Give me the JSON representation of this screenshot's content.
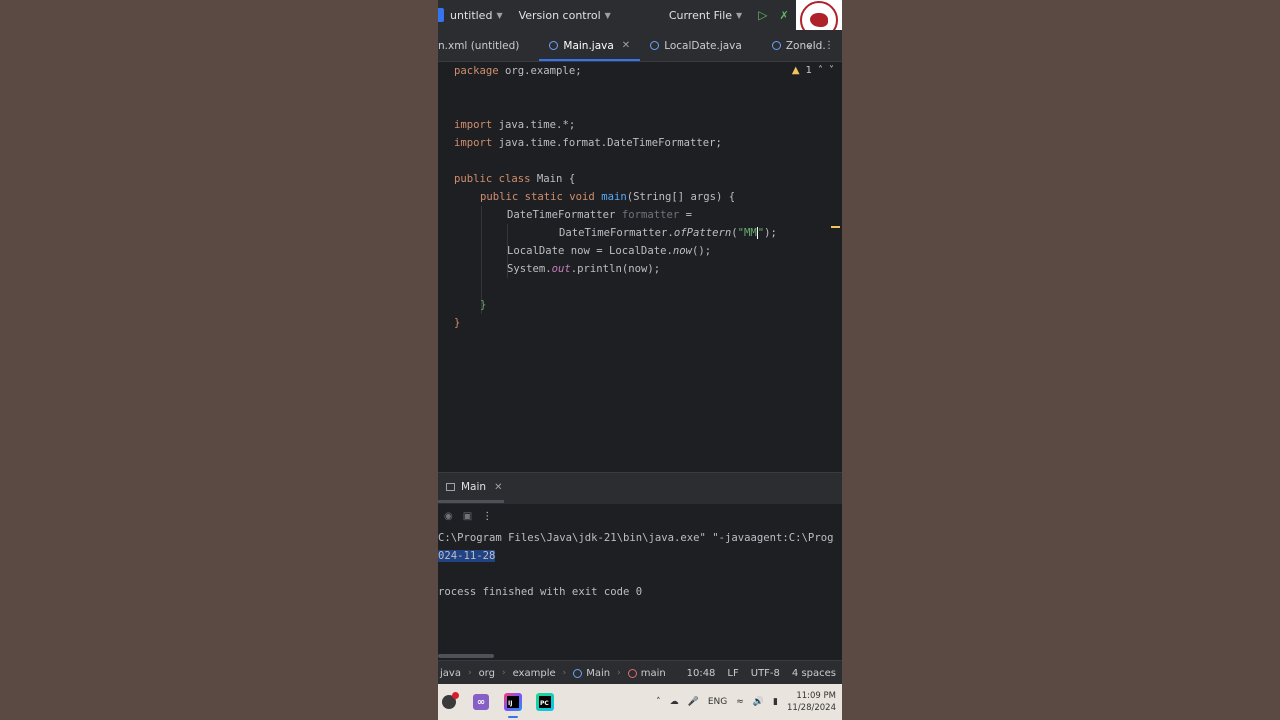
{
  "toolbar": {
    "project": "untitled",
    "vcs": "Version control",
    "run_config": "Current File"
  },
  "tabs": [
    {
      "label": "n.xml (untitled)"
    },
    {
      "label": "Main.java"
    },
    {
      "label": "LocalDate.java"
    },
    {
      "label": "ZoneId."
    }
  ],
  "editor": {
    "warning_count": "1",
    "lines": {
      "l1": {
        "kw": "package",
        "rest": " org.example;"
      },
      "l4": {
        "kw": "import",
        "rest": " java.time.*;"
      },
      "l5": {
        "kw": "import",
        "rest": " java.time.format.DateTimeFormatter;"
      },
      "l7": {
        "kw": "public class",
        "name": " Main",
        "rest": " {"
      },
      "l8": {
        "kw": "public static void",
        "fn": " main",
        "rest": "(String[] args) {"
      },
      "l9": {
        "type": "DateTimeFormatter ",
        "var": "formatter",
        "rest": " ="
      },
      "l10": {
        "cls": "DateTimeFormatter.",
        "method": "ofPattern",
        "open": "(",
        "str": "\"MM",
        "caret_after": "\"",
        "close": ");"
      },
      "l11": {
        "type": "LocalDate now = LocalDate.",
        "method": "now",
        "rest": "();"
      },
      "l12": {
        "cls": "System.",
        "field": "out",
        "rest": ".println(now);"
      },
      "l14": {
        "rest": "}"
      },
      "l15": {
        "rest": "}"
      }
    }
  },
  "run": {
    "tab_label": "Main",
    "console": {
      "cmd": ":\\Program Files\\Java\\jdk-21\\bin\\java.exe\" \"-javaagent:C:\\Prog",
      "cmd_prefix": "C",
      "output": "024-11-28",
      "exit": "rocess finished with exit code 0"
    }
  },
  "statusbar": {
    "crumbs": [
      "java",
      "org",
      "example",
      "Main",
      "main"
    ],
    "position": "10:48",
    "line_sep": "LF",
    "encoding": "UTF-8",
    "indent": "4 spaces"
  },
  "taskbar": {
    "lang": "ENG",
    "time": "11:09 PM",
    "date": "11/28/2024"
  }
}
